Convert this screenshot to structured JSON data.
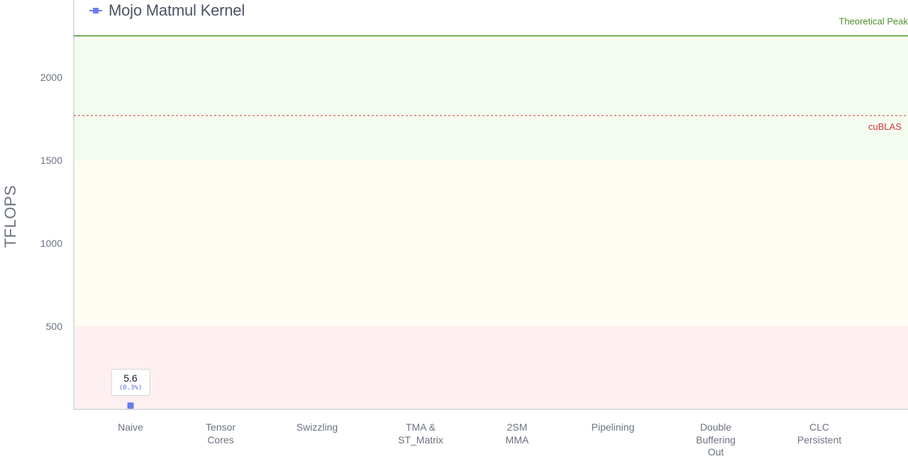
{
  "chart_data": {
    "type": "line",
    "legend": {
      "label": "Mojo Matmul Kernel",
      "color": "#6b7cf0"
    },
    "ylabel": "TFLOPS",
    "categories": [
      "Naive",
      "Tensor\nCores",
      "Swizzling",
      "TMA &\nST_Matrix",
      "2SM\nMMA",
      "Pipelining",
      "Double\nBuffering\nOut",
      "CLC\nPersistent"
    ],
    "series": [
      {
        "name": "Mojo Matmul Kernel",
        "values": [
          5.6,
          null,
          null,
          null,
          null,
          null,
          null,
          null
        ],
        "percent_labels": [
          "(0.3%)",
          null,
          null,
          null,
          null,
          null,
          null,
          null
        ]
      }
    ],
    "yticks": [
      500,
      1000,
      1500,
      2000
    ],
    "ylim": [
      0,
      2450
    ],
    "reference_lines": [
      {
        "label": "Theoretical Peak",
        "value": 2250,
        "color": "#4d8f2a",
        "style": "solid"
      },
      {
        "label": "cuBLAS",
        "value": 1770,
        "color": "#d03a3a",
        "style": "dashed"
      }
    ],
    "bands": [
      {
        "from": 0,
        "to": 500,
        "color": "#fef0f0"
      },
      {
        "from": 500,
        "to": 1500,
        "color": "#fefcf3"
      },
      {
        "from": 1500,
        "to": 2250,
        "color": "#f4fbf0"
      }
    ],
    "tooltip": {
      "value": "5.6",
      "percent": "(0.3%)"
    }
  }
}
